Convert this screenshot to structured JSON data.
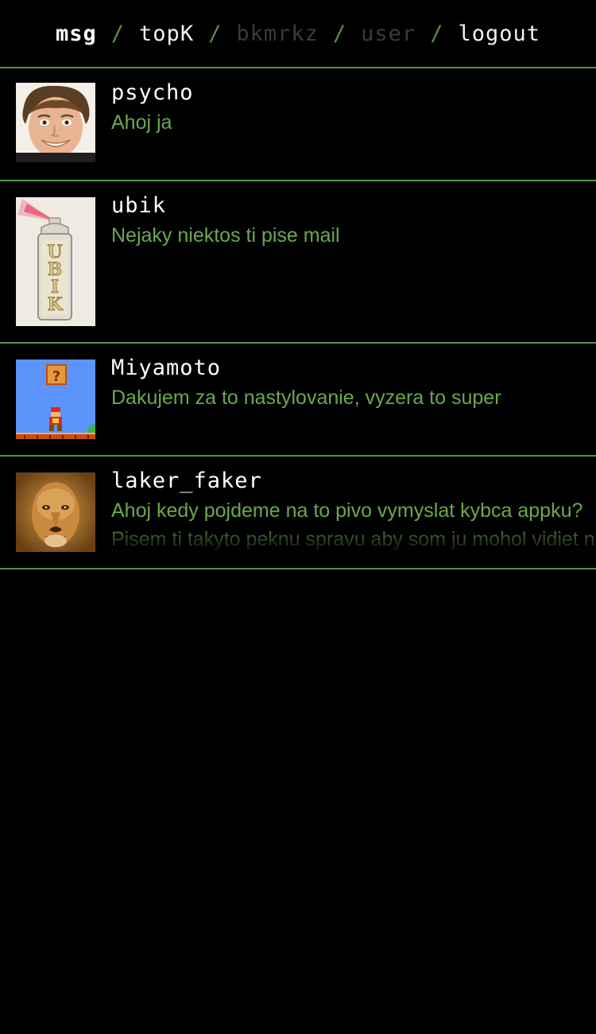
{
  "nav": {
    "items": [
      {
        "label": "msg"
      },
      {
        "label": "topK"
      },
      {
        "label": "bkmrkz"
      },
      {
        "label": "user"
      },
      {
        "label": "logout"
      }
    ],
    "separator": "/"
  },
  "messages": [
    {
      "username": "psycho",
      "text": "Ahoj ja",
      "avatar_icon": "portrait-photo"
    },
    {
      "username": "ubik",
      "text": "Nejaky niektos ti pise mail",
      "avatar_icon": "spray-can-ubik",
      "avatar_label": "UBIK"
    },
    {
      "username": "Miyamoto",
      "text": "Dakujem za to nastylovanie, vyzera to super",
      "avatar_icon": "mario-pixel"
    },
    {
      "username": "laker_faker",
      "text": "Ahoj kedy pojdeme na to pivo vymyslat kybca appku? Pisem ti takyto peknu spravu aby som ju mohol vidiet na obrazovke v aplikacii",
      "avatar_icon": "lion-face"
    }
  ],
  "colors": {
    "accent": "#5b8f43",
    "message_text": "#6aa84f",
    "background": "#000000"
  }
}
